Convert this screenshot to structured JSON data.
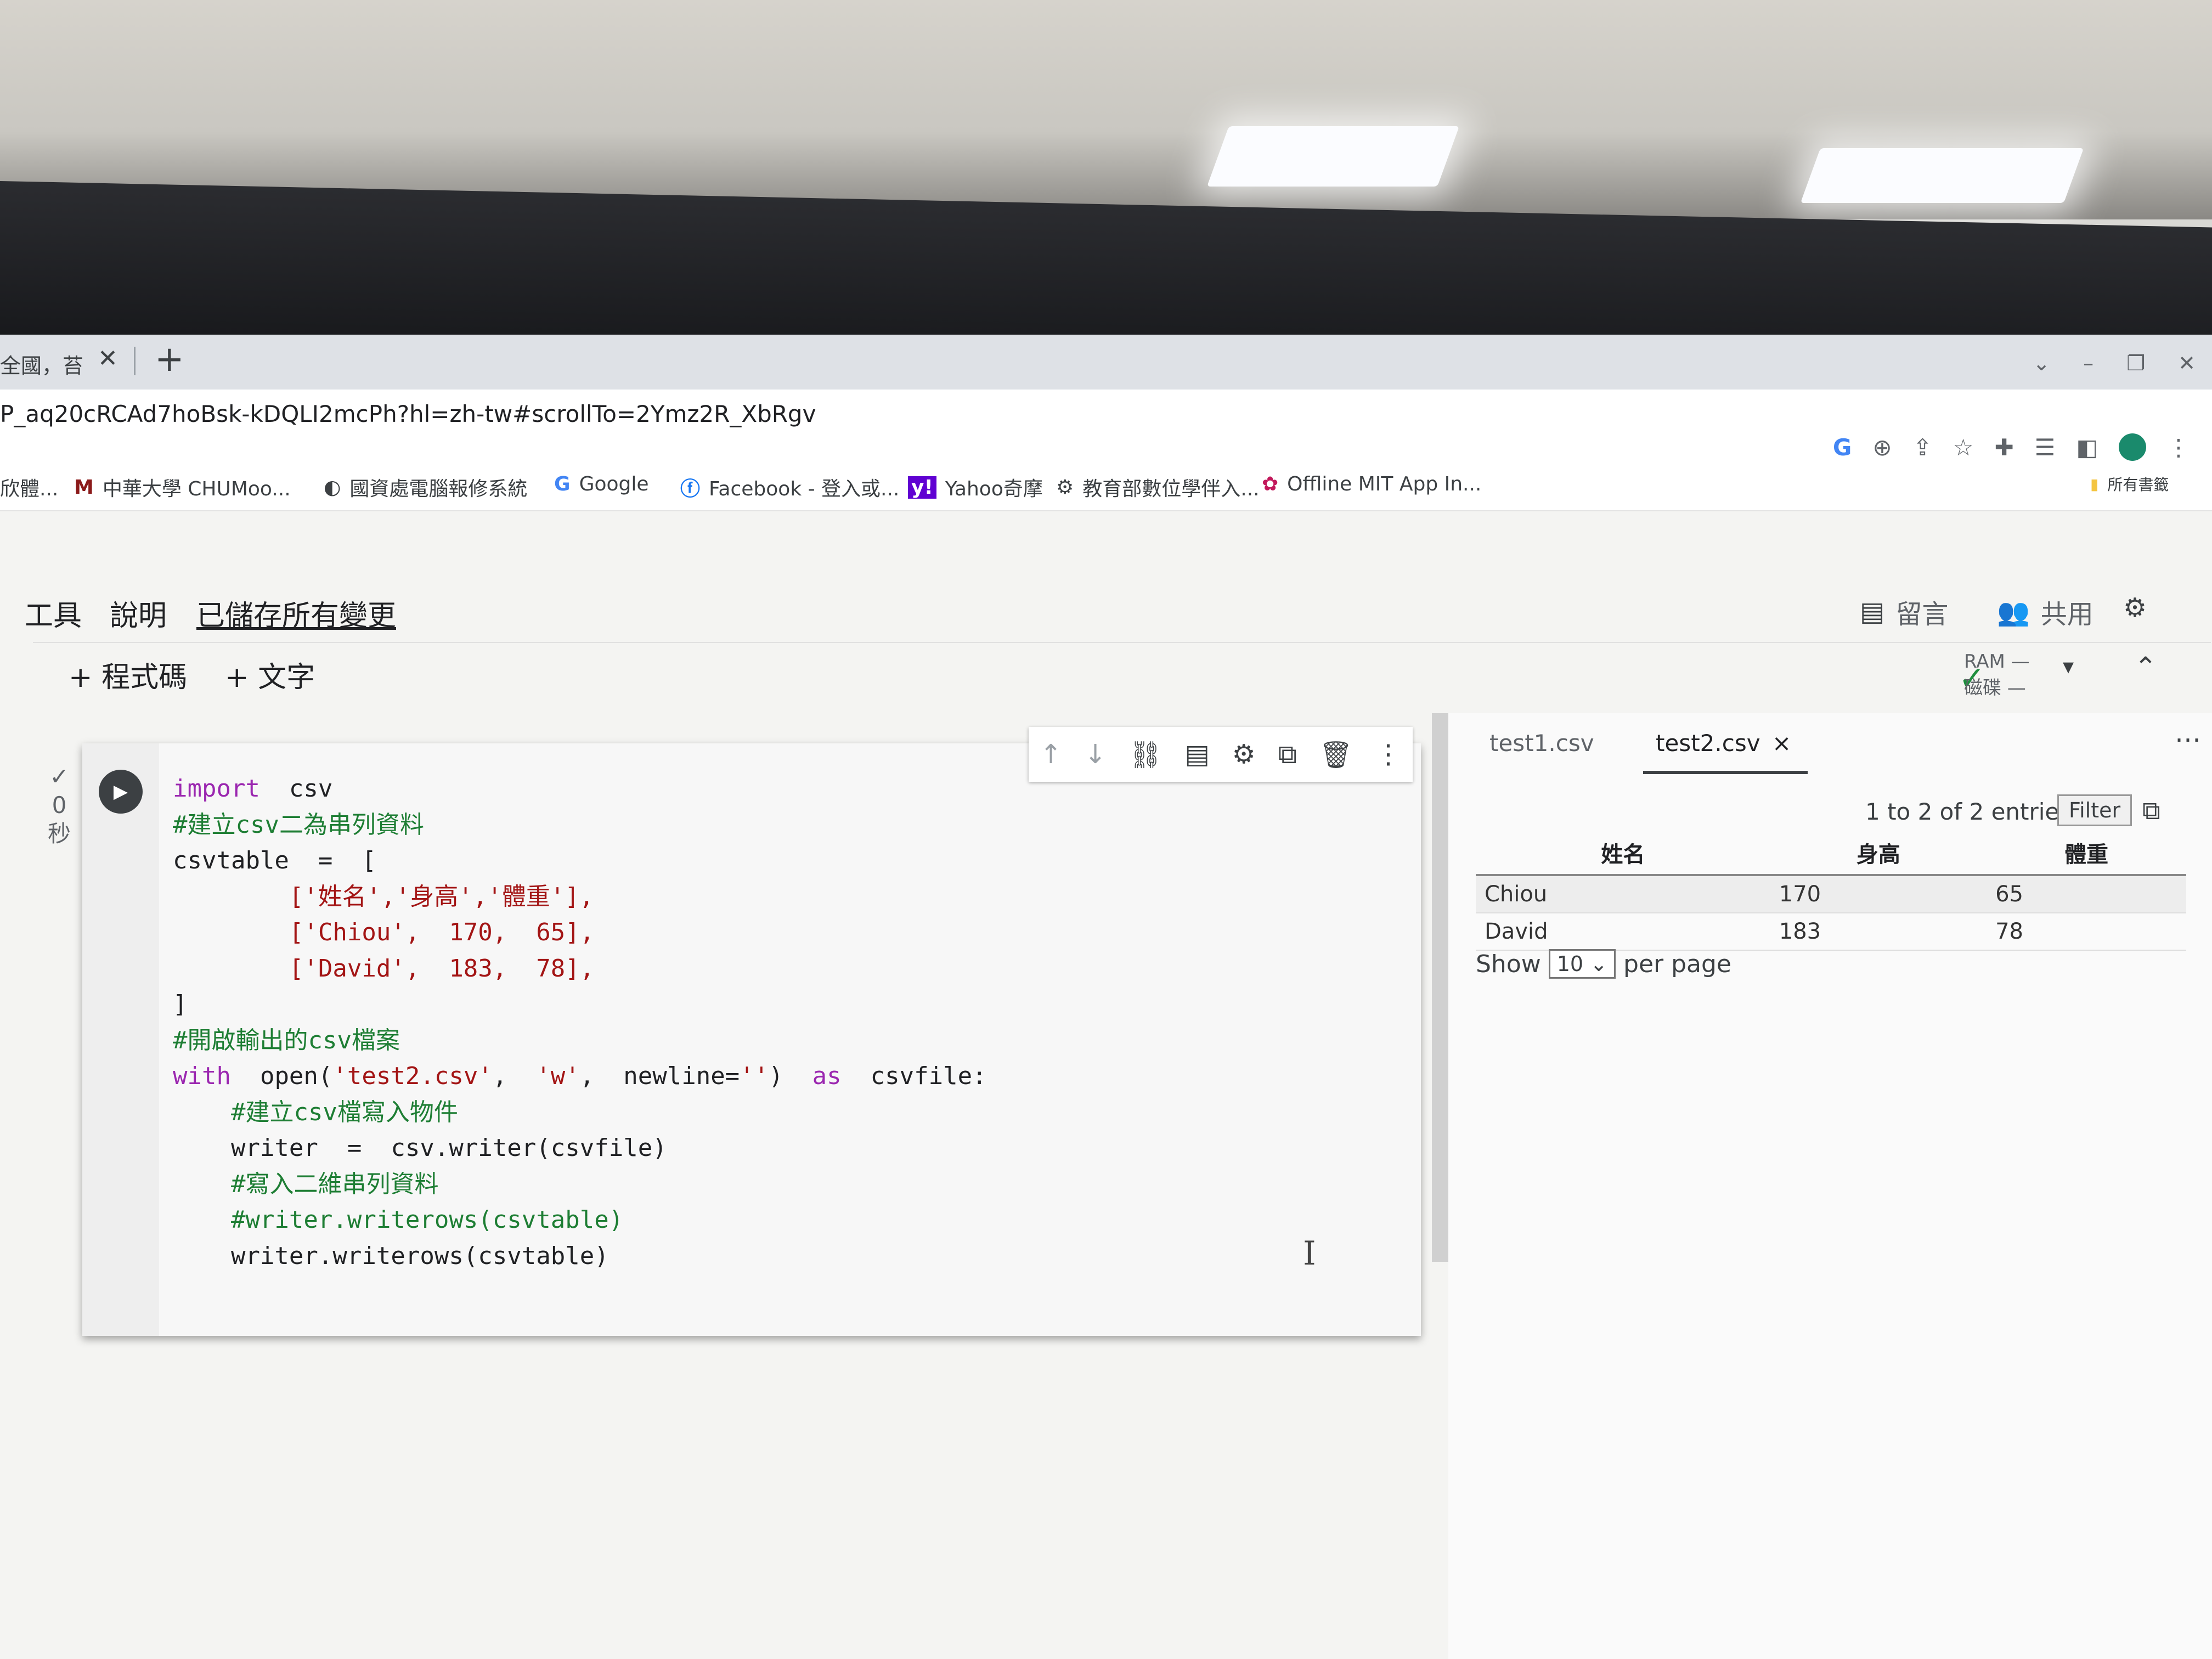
{
  "browser": {
    "tab_title": "全國，苔",
    "url": "P_aq20cRCAd7hoBsk-kDQLI2mcPh?hl=zh-tw#scrollTo=2Ymz2R_XbRgv",
    "bookmarks": [
      {
        "icon": "chinese-text-icon",
        "label": "欣體..."
      },
      {
        "icon": "m-icon",
        "label": "中華大學 CHUMoo..."
      },
      {
        "icon": "globe-icon",
        "label": "國資處電腦報修系統"
      },
      {
        "icon": "google-icon",
        "label": "Google"
      },
      {
        "icon": "facebook-icon",
        "label": "Facebook - 登入或..."
      },
      {
        "icon": "yahoo-icon",
        "label": "Yahoo奇摩"
      },
      {
        "icon": "gear-icon",
        "label": "教育部數位學伴入..."
      },
      {
        "icon": "app-inventor-icon",
        "label": "Offline MIT App In..."
      }
    ],
    "bookmarks_right": "所有書籤"
  },
  "colab": {
    "menu": [
      "工具",
      "說明"
    ],
    "saved_status": "已儲存所有變更",
    "comment_label": "留言",
    "share_label": "共用",
    "add_code": "+ 程式碼",
    "add_text": "+ 文字",
    "ram_label": "RAM",
    "disk_label": "磁碟",
    "exec_time": [
      "0",
      "秒"
    ]
  },
  "code_lines": [
    "import  csv",
    "#建立csv二為串列資料",
    "csvtable  =  [",
    "        ['姓名','身高','體重'],",
    "        ['Chiou',  170,  65],",
    "        ['David',  183,  78],",
    "]",
    "#開啟輸出的csv檔案",
    "with  open('test2.csv',  'w',  newline='')  as  csvfile:",
    "    #建立csv檔寫入物件",
    "    writer  =  csv.writer(csvfile)",
    "",
    "    #寫入二維串列資料",
    "    #writer.writerows(csvtable)",
    "    writer.writerows(csvtable)"
  ],
  "file_pane": {
    "tabs": [
      "test1.csv",
      "test2.csv"
    ],
    "close_icon": "×",
    "entries_text": "1 to 2 of 2 entries",
    "filter_label": "Filter",
    "columns": [
      "姓名",
      "身高",
      "體重"
    ],
    "rows": [
      [
        "Chiou",
        "170",
        "65"
      ],
      [
        "David",
        "183",
        "78"
      ]
    ],
    "show_label": "Show",
    "page_size": "10",
    "per_page_label": "per page"
  }
}
